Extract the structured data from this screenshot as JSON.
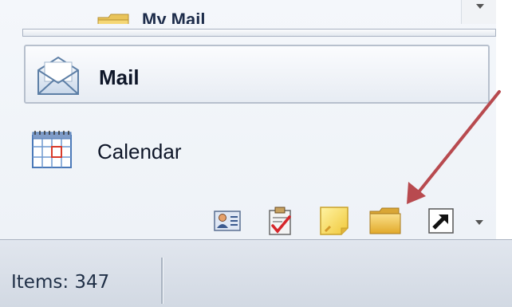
{
  "navigation": {
    "top_item_label": "My Mail",
    "mail_label": "Mail",
    "calendar_label": "Calendar"
  },
  "shortcuts": [
    {
      "name": "contacts-icon"
    },
    {
      "name": "tasks-icon"
    },
    {
      "name": "notes-icon"
    },
    {
      "name": "folder-list-icon"
    },
    {
      "name": "shortcuts-icon"
    }
  ],
  "status": {
    "items_text": "Items: 347"
  },
  "colors": {
    "annotation_arrow": "#b84a4f",
    "mail_border": "#b7c0cd",
    "statusbar": "#d9dfe7"
  }
}
